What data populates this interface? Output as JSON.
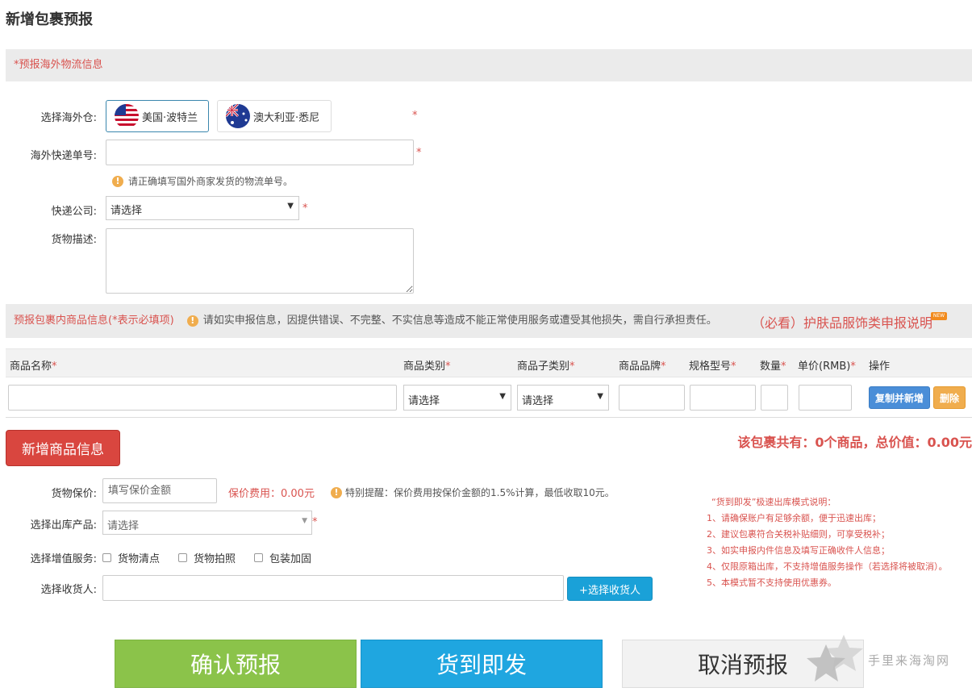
{
  "page": {
    "title": "新增包裹预报"
  },
  "section1": {
    "title": "*预报海外物流信息"
  },
  "warehouse": {
    "label": "选择海外仓:",
    "options": [
      {
        "label": "美国·波特兰",
        "flag": "us-flag-icon",
        "selected": true
      },
      {
        "label": "澳大利亚·悉尼",
        "flag": "au-flag-icon",
        "selected": false
      }
    ],
    "required_mark": "*"
  },
  "tracking": {
    "label": "海外快递单号:",
    "value": "",
    "required_mark": "*",
    "hint": "请正确填写国外商家发货的物流单号。"
  },
  "courier": {
    "label": "快递公司:",
    "selected": "请选择",
    "required_mark": "*"
  },
  "description": {
    "label": "货物描述:",
    "value": ""
  },
  "section2": {
    "title": "预报包裹内商品信息(*表示必填项)",
    "warning": "请如实申报信息，因提供错误、不完整、不实信息等造成不能正常使用服务或遭受其他损失，需自行承担责任。",
    "link": "（必看）护肤品服饰类申报说明",
    "new_tag": "NEW"
  },
  "table": {
    "headers": [
      {
        "label": "商品名称",
        "req": "*"
      },
      {
        "label": "商品类别",
        "req": "*"
      },
      {
        "label": "商品子类别",
        "req": "*"
      },
      {
        "label": "商品品牌",
        "req": "*"
      },
      {
        "label": "规格型号",
        "req": "*"
      },
      {
        "label": "数量",
        "req": "*"
      },
      {
        "label": "单价(RMB)",
        "req": "*"
      },
      {
        "label": "操作",
        "req": ""
      }
    ],
    "row": {
      "category": "请选择",
      "subcategory": "请选择",
      "copy_label": "复制并新增",
      "delete_label": "删除"
    }
  },
  "add_item": {
    "label": "新增商品信息"
  },
  "summary": {
    "text": "该包裹共有：0个商品，总价值：0.00元"
  },
  "insurance": {
    "label": "货物保价:",
    "placeholder": "填写保价金额",
    "fee": "保价费用：0.00元",
    "tip": "特别提醒：保价费用按保价金额的1.5%计算，最低收取10元。"
  },
  "product": {
    "label": "选择出库产品:",
    "placeholder": "请选择",
    "required_mark": "*"
  },
  "services": {
    "label": "选择增值服务:",
    "options": [
      "货物清点",
      "货物拍照",
      "包装加固"
    ]
  },
  "receiver": {
    "label": "选择收货人:",
    "value": "",
    "button": "+选择收货人"
  },
  "notes": {
    "title": "“货到即发”极速出库模式说明：",
    "items": [
      "1、请确保账户有足够余额，便于迅速出库；",
      "2、建议包裹符合关税补贴细则，可享受税补；",
      "3、如实申报内件信息及填写正确收件人信息；",
      "4、仅限原箱出库，不支持增值服务操作（若选择将被取消）。",
      "5、本模式暂不支持使用优惠券。"
    ]
  },
  "actions": {
    "confirm": "确认预报",
    "express": "货到即发",
    "cancel": "取消预报"
  },
  "watermark": {
    "text": "手里来海淘网"
  }
}
